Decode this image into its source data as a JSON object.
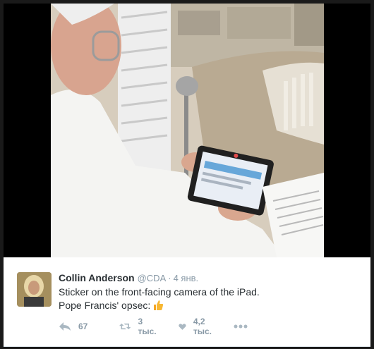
{
  "tweet": {
    "author_name": "Collin Anderson",
    "handle": "@CDA",
    "separator": "·",
    "date": "4 янв.",
    "text_line1": "Sticker on the front-facing camera of the iPad.",
    "text_line2": "Pope Francis' opsec:",
    "emoji_icon": "thumbs-up-emoji-icon"
  },
  "photo": {
    "description_icon": "photo-pope-with-ipad"
  },
  "actions": {
    "reply_count": "67",
    "retweet_count": "3 тыс.",
    "like_count": "4,2 тыс.",
    "more_icon": "more-dots-icon"
  },
  "colors": {
    "text": "#292f33",
    "muted": "#8899a6",
    "card_bg": "#ffffff",
    "frame_bg": "#1a1a1a"
  }
}
